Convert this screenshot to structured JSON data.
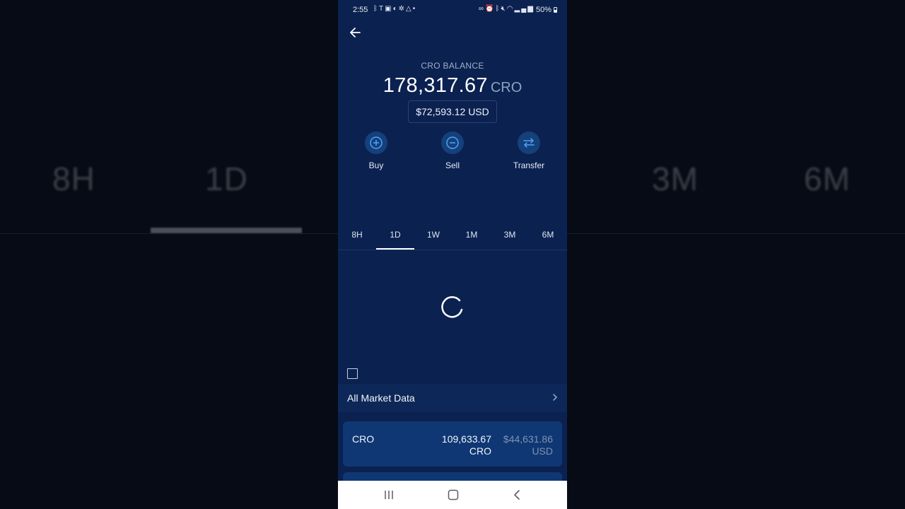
{
  "background_tabs": [
    "8H",
    "1D",
    "3M",
    "6M"
  ],
  "status_bar": {
    "time": "2:55",
    "left_icons": [
      "bluetooth-icon",
      "t-mobile-icon",
      "message-icon",
      "compass-icon",
      "settings-icon",
      "navigation-icon",
      "dot-icon"
    ],
    "right_icons": [
      "link-icon",
      "alarm-icon",
      "bluetooth-icon",
      "mute-icon",
      "wifi-icon",
      "signal-icon"
    ],
    "battery": "50%"
  },
  "header": {
    "back_icon": "arrow-left-icon"
  },
  "balance": {
    "label": "CRO BALANCE",
    "amount": "178,317.67",
    "unit": "CRO",
    "usd": "$72,593.12 USD"
  },
  "actions": [
    {
      "label": "Buy",
      "icon": "plus-circle-icon"
    },
    {
      "label": "Sell",
      "icon": "minus-circle-icon"
    },
    {
      "label": "Transfer",
      "icon": "transfer-arrows-icon"
    }
  ],
  "tabs": [
    "8H",
    "1D",
    "1W",
    "1M",
    "3M",
    "6M"
  ],
  "selected_tab": "1D",
  "market": {
    "label": "All Market Data"
  },
  "holdings": [
    {
      "name": "CRO",
      "amount_line1": "109,633.67",
      "amount_line2": "CRO",
      "usd_line1": "$44,631.86",
      "usd_line2": "USD"
    }
  ],
  "colors": {
    "app_background": "#0b2150",
    "card_background": "#0f3773",
    "accent": "#16407a"
  }
}
